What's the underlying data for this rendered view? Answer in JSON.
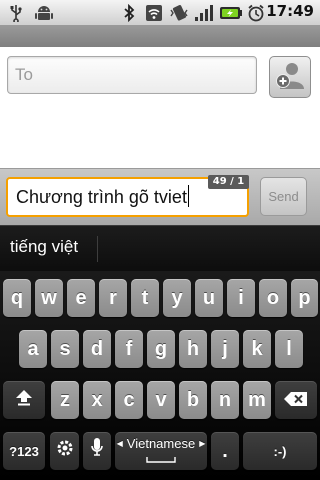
{
  "status_bar": {
    "time": "17:49",
    "icons": [
      "usb-icon",
      "android-debug-icon",
      "bluetooth-icon",
      "wifi-icon",
      "vibrate-icon",
      "signal-icon",
      "battery-charging-icon",
      "alarm-icon"
    ]
  },
  "compose": {
    "to_placeholder": "To"
  },
  "message": {
    "text": "Chương trình gõ tviet",
    "counter": "49 / 1",
    "send_label": "Send"
  },
  "suggestions": {
    "candidate": "tiếng việt"
  },
  "keyboard": {
    "row1": [
      "q",
      "w",
      "e",
      "r",
      "t",
      "y",
      "u",
      "i",
      "o",
      "p"
    ],
    "row2": [
      "a",
      "s",
      "d",
      "f",
      "g",
      "h",
      "j",
      "k",
      "l"
    ],
    "row3": [
      "z",
      "x",
      "c",
      "v",
      "b",
      "n",
      "m"
    ],
    "symbols_label": "?123",
    "language_label": "Vietnamese",
    "period_label": ".",
    "smiley_label": ":-)"
  },
  "colors": {
    "focus_border": "#f5a000",
    "key_light": "#9a9a9a",
    "key_dark": "#333333"
  }
}
